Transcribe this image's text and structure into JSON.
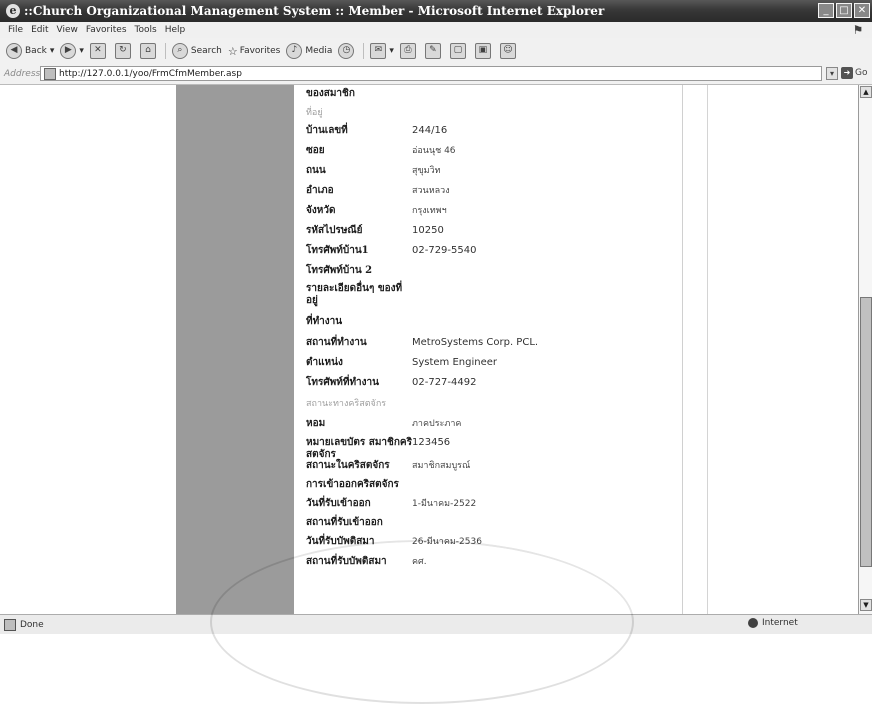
{
  "window": {
    "title": "::Church Organizational Management System :: Member - Microsoft Internet Explorer"
  },
  "menu": [
    "File",
    "Edit",
    "View",
    "Favorites",
    "Tools",
    "Help"
  ],
  "toolbar": {
    "back": "Back",
    "search": "Search",
    "favorites": "Favorites",
    "media": "Media"
  },
  "address": {
    "label": "Address",
    "url": "http://127.0.0.1/yoo/FrmCfmMember.asp",
    "go": "Go"
  },
  "form": {
    "rows": [
      {
        "label": "ของสมาชิก",
        "value": "",
        "style": "bold"
      },
      {
        "label": "ที่อยู่",
        "value": "",
        "style": "light"
      },
      {
        "label": "บ้านเลขที่",
        "value": "244/16",
        "style": "bold"
      },
      {
        "label": "ซอย",
        "value": "อ่อนนุช 46",
        "style": "bold"
      },
      {
        "label": "ถนน",
        "value": "สุขุมวิท",
        "style": "bold"
      },
      {
        "label": "อำเภอ",
        "value": "สวนหลวง",
        "style": "bold"
      },
      {
        "label": "จังหวัด",
        "value": "กรุงเทพฯ",
        "style": "bold"
      },
      {
        "label": "รหัสไปรษณีย์",
        "value": "10250",
        "style": "bold"
      },
      {
        "label": "โทรศัพท์บ้าน1",
        "value": "02-729-5540",
        "style": "bold"
      },
      {
        "label": "โทรศัพท์บ้าน 2",
        "value": "",
        "style": "bold"
      },
      {
        "label": "รายละเอียดอื่นๆ ของที่อยู่",
        "value": "",
        "style": "bold"
      },
      {
        "label": "ที่ทำงาน",
        "value": "",
        "style": "bold"
      },
      {
        "label": "สถานที่ทำงาน",
        "value": "MetroSystems Corp. PCL.",
        "style": "bold"
      },
      {
        "label": "ตำแหน่ง",
        "value": "System Engineer",
        "style": "bold"
      },
      {
        "label": "โทรศัพท์ที่ทำงาน",
        "value": "02-727-4492",
        "style": "bold"
      },
      {
        "label": "สถานะทางคริสตจักร",
        "value": "",
        "style": "light"
      },
      {
        "label": "หอม",
        "value": "ภาคประภาค",
        "style": "bold"
      },
      {
        "label": "หมายเลขบัตร สมาชิกคริสตจักร",
        "value": "123456",
        "style": "bold"
      },
      {
        "label": "สถานะในคริสตจักร",
        "value": "สมาชิกสมบูรณ์",
        "style": "bold"
      },
      {
        "label": "การเข้าออกคริสตจักร",
        "value": "",
        "style": "bold"
      },
      {
        "label": "วันที่รับเข้าออก",
        "value": "1-มีนาคม-2522",
        "style": "bold"
      },
      {
        "label": "สถานที่รับเข้าออก",
        "value": "",
        "style": "bold"
      },
      {
        "label": "วันที่รับบัพติสมา",
        "value": "26-มีนาคม-2536",
        "style": "bold"
      },
      {
        "label": "สถานที่รับบัพติสมา",
        "value": "คศ.",
        "style": "bold"
      }
    ]
  },
  "status": {
    "left": "Done",
    "zone": "Internet"
  }
}
